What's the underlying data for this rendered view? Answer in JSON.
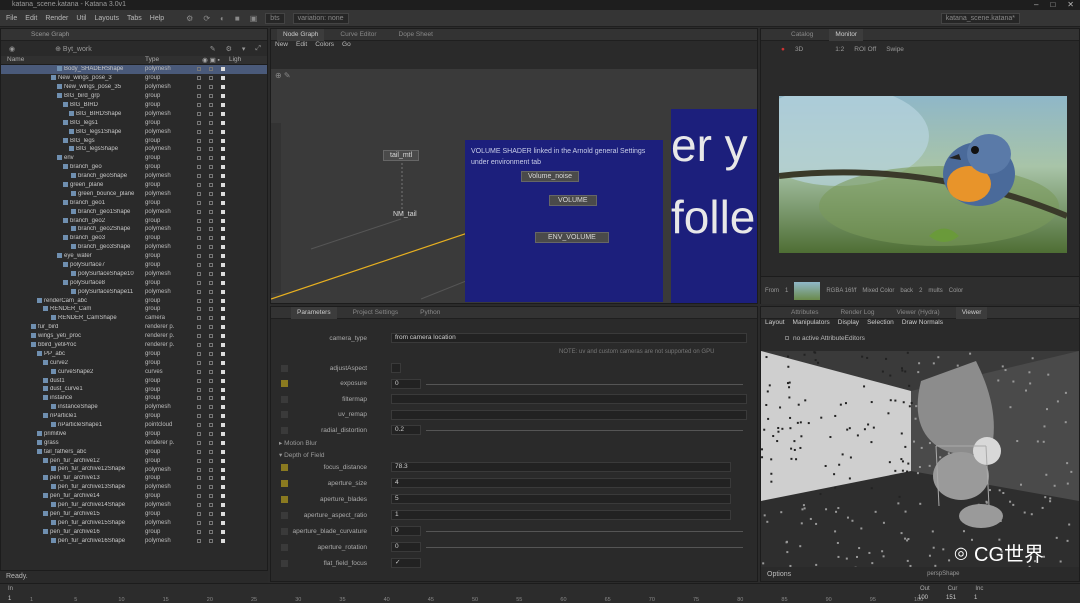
{
  "window": {
    "title": "katana_scene.katana - Katana 3.0v1",
    "controls": [
      "–",
      "□",
      "✕"
    ]
  },
  "menu": {
    "items": [
      "File",
      "Edit",
      "Render",
      "Util",
      "Layouts",
      "Tabs",
      "Help"
    ],
    "field1": "bts",
    "field2": "variation: none",
    "right_title": "katana_scene.katana*"
  },
  "scene_graph": {
    "title": "Scene Graph",
    "location": "Byt_work",
    "columns": {
      "name": "Name",
      "type": "Type",
      "light": "Ligh"
    },
    "rows": [
      {
        "name": "Body_SHADERShape",
        "type": "polymesh",
        "ind": 56,
        "sel": true
      },
      {
        "name": "New_wings_pose_3",
        "type": "group",
        "ind": 50
      },
      {
        "name": "New_wings_pose_35",
        "type": "polymesh",
        "ind": 56
      },
      {
        "name": "BIG_bird_grp",
        "type": "group",
        "ind": 56
      },
      {
        "name": "BIG_BIRD",
        "type": "group",
        "ind": 62
      },
      {
        "name": "BIG_BIRDShape",
        "type": "polymesh",
        "ind": 68
      },
      {
        "name": "BIG_legs1",
        "type": "group",
        "ind": 62
      },
      {
        "name": "BIG_legs1Shape",
        "type": "polymesh",
        "ind": 68
      },
      {
        "name": "BIG_legs",
        "type": "group",
        "ind": 62
      },
      {
        "name": "BIG_legsShape",
        "type": "polymesh",
        "ind": 68
      },
      {
        "name": "env",
        "type": "group",
        "ind": 56
      },
      {
        "name": "branch_geo",
        "type": "group",
        "ind": 62
      },
      {
        "name": "branch_geoShape",
        "type": "polymesh",
        "ind": 70
      },
      {
        "name": "green_plane",
        "type": "group",
        "ind": 62
      },
      {
        "name": "green_bounce_plane",
        "type": "polymesh",
        "ind": 70
      },
      {
        "name": "branch_geo1",
        "type": "group",
        "ind": 62
      },
      {
        "name": "branch_geo1Shape",
        "type": "polymesh",
        "ind": 70
      },
      {
        "name": "branch_geo2",
        "type": "group",
        "ind": 62
      },
      {
        "name": "branch_geo2Shape",
        "type": "polymesh",
        "ind": 70
      },
      {
        "name": "branch_geo3",
        "type": "group",
        "ind": 62
      },
      {
        "name": "branch_geo3Shape",
        "type": "polymesh",
        "ind": 70
      },
      {
        "name": "eye_water",
        "type": "group",
        "ind": 56
      },
      {
        "name": "polySurface7",
        "type": "group",
        "ind": 62
      },
      {
        "name": "polySurfaceShape10",
        "type": "polymesh",
        "ind": 70
      },
      {
        "name": "polySurface8",
        "type": "group",
        "ind": 62
      },
      {
        "name": "polySurfaceShape11",
        "type": "polymesh",
        "ind": 70
      },
      {
        "name": "renderCam_abc",
        "type": "group",
        "ind": 36
      },
      {
        "name": "RENDER_Cam",
        "type": "group",
        "ind": 42
      },
      {
        "name": "RENDER_CamShape",
        "type": "camera",
        "ind": 50
      },
      {
        "name": "fur_bird",
        "type": "renderer p.",
        "ind": 30
      },
      {
        "name": "wings_yeti_proc",
        "type": "renderer p.",
        "ind": 30
      },
      {
        "name": "bbird_yetiProc",
        "type": "renderer p.",
        "ind": 30
      },
      {
        "name": "PP_abc",
        "type": "group",
        "ind": 36
      },
      {
        "name": "curve2",
        "type": "group",
        "ind": 42
      },
      {
        "name": "curveShape2",
        "type": "curves",
        "ind": 50
      },
      {
        "name": "dust1",
        "type": "group",
        "ind": 42
      },
      {
        "name": "dust_curve1",
        "type": "group",
        "ind": 42
      },
      {
        "name": "instance",
        "type": "group",
        "ind": 42
      },
      {
        "name": "instanceShape",
        "type": "polymesh",
        "ind": 50
      },
      {
        "name": "nParticle1",
        "type": "group",
        "ind": 42
      },
      {
        "name": "nParticleShape1",
        "type": "pointcloud",
        "ind": 50
      },
      {
        "name": "primitive",
        "type": "group",
        "ind": 36
      },
      {
        "name": "grass",
        "type": "renderer p.",
        "ind": 36
      },
      {
        "name": "tail_fathers_abc",
        "type": "group",
        "ind": 36
      },
      {
        "name": "pen_fur_archive12",
        "type": "group",
        "ind": 42
      },
      {
        "name": "pen_fur_archive12Shape",
        "type": "polymesh",
        "ind": 50
      },
      {
        "name": "pen_fur_archive13",
        "type": "group",
        "ind": 42
      },
      {
        "name": "pen_fur_archive13Shape",
        "type": "polymesh",
        "ind": 50
      },
      {
        "name": "pen_fur_archive14",
        "type": "group",
        "ind": 42
      },
      {
        "name": "pen_fur_archive14Shape",
        "type": "polymesh",
        "ind": 50
      },
      {
        "name": "pen_fur_archive15",
        "type": "group",
        "ind": 42
      },
      {
        "name": "pen_fur_archive15Shape",
        "type": "polymesh",
        "ind": 50
      },
      {
        "name": "pen_fur_archive16",
        "type": "group",
        "ind": 42
      },
      {
        "name": "pen_fur_archive16Shape",
        "type": "polymesh",
        "ind": 50
      }
    ],
    "status": "Ready."
  },
  "node_graph": {
    "tabs": [
      "Node Graph",
      "Curve Editor",
      "Dope Sheet"
    ],
    "menu": [
      "New",
      "Edit",
      "Colors",
      "Go"
    ],
    "nodes": {
      "tail": "tail_mtl",
      "nm": "NM_tail",
      "noise": "Volume_noise",
      "volume": "VOLUME",
      "env": "ENV_VOLUME"
    },
    "note": "VOLUME SHADER linked in the Arnold general Settings under environment  tab",
    "big_text": "er y\nfolle"
  },
  "monitor": {
    "tabs": [
      "Catalog",
      "Monitor"
    ],
    "toolbar": [
      "3D",
      "1:2",
      "ROI Off",
      "Swipe"
    ],
    "footer": [
      "From",
      "1",
      "Mixed Color",
      "RGBA 16f/f",
      "back",
      "2",
      "mults",
      "Color"
    ]
  },
  "params": {
    "tabs": [
      "Parameters",
      "Project Settings",
      "Python"
    ],
    "camera_type_label": "camera_type",
    "camera_type_value": "from camera location",
    "note": "NOTE: uv and custom cameras are not supported on GPU",
    "rows": [
      {
        "label": "adjustAspect",
        "value": ""
      },
      {
        "label": "exposure",
        "value": "0"
      },
      {
        "label": "filtermap",
        "value": ""
      },
      {
        "label": "uv_remap",
        "value": ""
      },
      {
        "label": "radial_distortion",
        "value": "0.2"
      }
    ],
    "section_motion": "Motion Blur",
    "section_dof": "Depth of Field",
    "dof_rows": [
      {
        "label": "focus_distance",
        "value": "78.3"
      },
      {
        "label": "aperture_size",
        "value": "4"
      },
      {
        "label": "aperture_blades",
        "value": "5"
      },
      {
        "label": "aperture_aspect_ratio",
        "value": "1"
      },
      {
        "label": "aperture_blade_curvature",
        "value": "0"
      },
      {
        "label": "aperture_rotation",
        "value": "0"
      },
      {
        "label": "flat_field_focus",
        "value": "✓"
      }
    ]
  },
  "viewer": {
    "tabs": [
      "Attributes",
      "Render Log",
      "Viewer (Hydra)",
      "Viewer"
    ],
    "menu": [
      "Layout",
      "Manipulators",
      "Display",
      "Selection",
      "Draw Normals"
    ],
    "message": "no active AttributeEditors",
    "options": "Options",
    "camera": "perspShape"
  },
  "timeline": {
    "ticks": [
      "1",
      "5",
      "10",
      "15",
      "20",
      "25",
      "30",
      "35",
      "40",
      "45",
      "50",
      "55",
      "60",
      "65",
      "70",
      "75",
      "80",
      "85",
      "90",
      "95",
      "100"
    ],
    "in_label": "In",
    "in_value": "1",
    "out_label": "Out",
    "out_value": "100",
    "cur_label": "Cur",
    "cur_value": "151",
    "inc_label": "Inc",
    "inc_value": "1"
  },
  "watermark": "CG世界"
}
